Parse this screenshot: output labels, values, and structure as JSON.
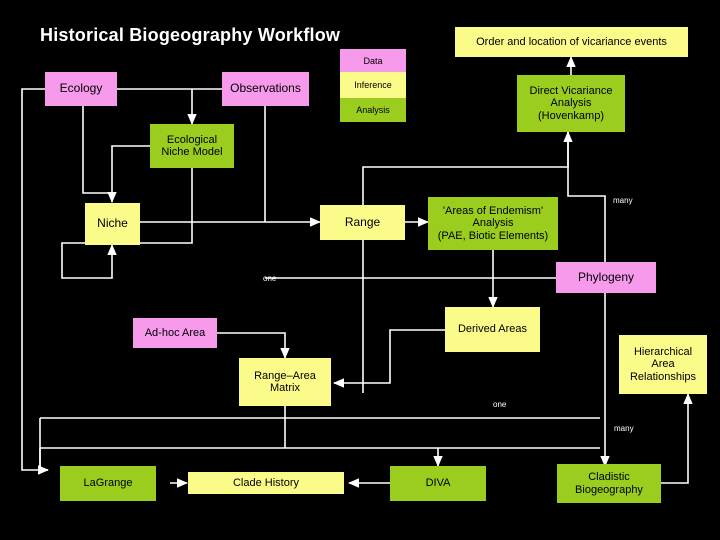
{
  "page": {
    "title": "Historical Biogeography Workflow",
    "background": "#000000",
    "line_color": "#ffffff",
    "colors": {
      "data": "#f79aec",
      "inference": "#fbfb8a",
      "analysis": "#9acd1e"
    }
  },
  "legend": {
    "name": "category-legend",
    "items": [
      {
        "label": "Data",
        "color": "#f79aec"
      },
      {
        "label": "Inference",
        "color": "#fbfb8a"
      },
      {
        "label": "Analysis",
        "color": "#9acd1e"
      }
    ]
  },
  "nodes": [
    {
      "id": "ecology",
      "label": "Ecology",
      "kind": "data"
    },
    {
      "id": "observations",
      "label": "Observations",
      "kind": "data"
    },
    {
      "id": "vicariance-events",
      "label": "Order and location of vicariance events",
      "kind": "inference"
    },
    {
      "id": "direct-vicariance",
      "label": "Direct Vicariance\nAnalysis\n(Hovenkamp)",
      "kind": "analysis"
    },
    {
      "id": "ecological-niche-model",
      "label": "Ecological\nNiche Model",
      "kind": "analysis"
    },
    {
      "id": "niche",
      "label": "Niche",
      "kind": "inference"
    },
    {
      "id": "range",
      "label": "Range",
      "kind": "inference"
    },
    {
      "id": "areas-endemism",
      "label": "'Areas of Endemism'\nAnalysis\n(PAE, Biotic Elements)",
      "kind": "analysis"
    },
    {
      "id": "phylogeny",
      "label": "Phylogeny",
      "kind": "data"
    },
    {
      "id": "ad-hoc-area",
      "label": "Ad-hoc Area",
      "kind": "data"
    },
    {
      "id": "derived-areas",
      "label": "Derived Areas",
      "kind": "inference"
    },
    {
      "id": "hierarchical-area",
      "label": "Hierarchical\nArea\nRelationships",
      "kind": "inference"
    },
    {
      "id": "range-area-matrix",
      "label": "Range–Area\nMatrix",
      "kind": "inference"
    },
    {
      "id": "lagrange",
      "label": "LaGrange",
      "kind": "analysis"
    },
    {
      "id": "clade-history",
      "label": "Clade History",
      "kind": "inference"
    },
    {
      "id": "diva",
      "label": "DIVA",
      "kind": "analysis"
    },
    {
      "id": "cladistic-biogeography",
      "label": "Cladistic\nBiogeography",
      "kind": "analysis"
    }
  ],
  "edge_labels": [
    {
      "id": "many-phylogeny",
      "text": "many"
    },
    {
      "id": "one-range",
      "text": "one"
    },
    {
      "id": "one-derived",
      "text": "one"
    },
    {
      "id": "many-cladistic",
      "text": "many"
    }
  ]
}
